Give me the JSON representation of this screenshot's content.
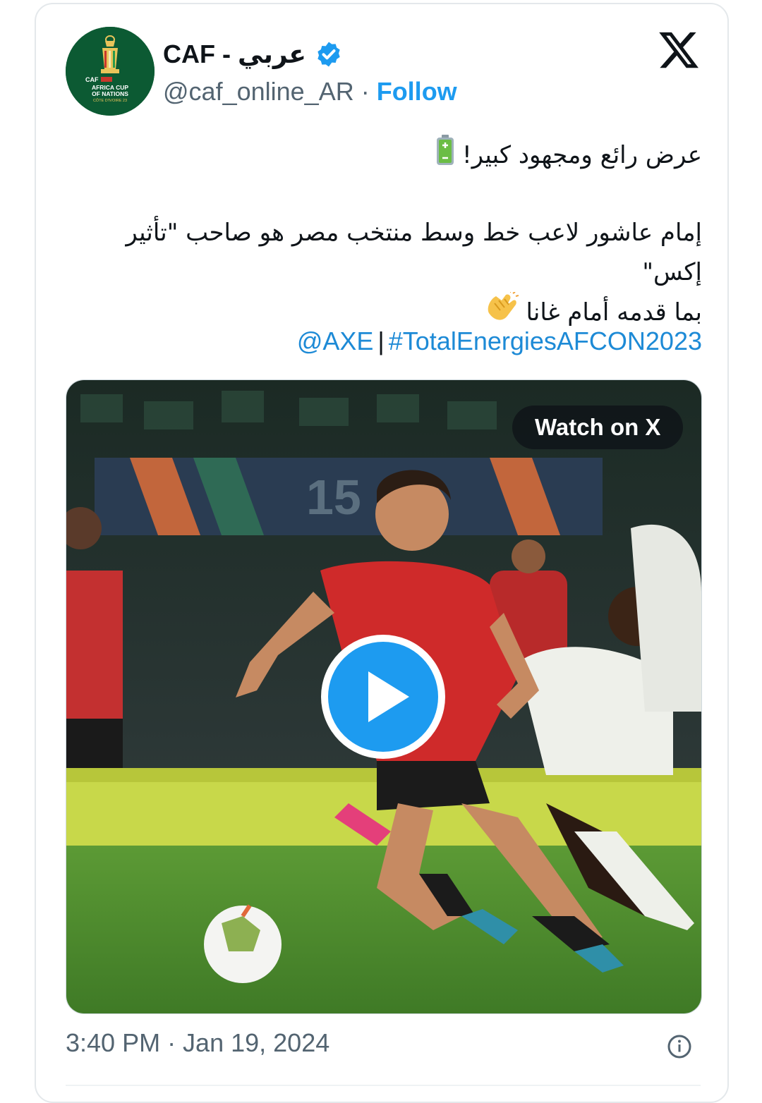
{
  "author": {
    "display_name": "CAF - عربي",
    "handle": "@caf_online_AR",
    "separator": "·",
    "follow_label": "Follow",
    "verified": true,
    "avatar_text": {
      "line1": "AFRICA CUP",
      "line2": "OF NATIONS",
      "line3": "CÔTE D'IVOIRE 23",
      "brand": "CAF"
    }
  },
  "tweet": {
    "line1": "عرض رائع ومجهود كبير!",
    "line1_emoji": "battery-icon",
    "line2": "إمام عاشور لاعب خط وسط منتخب مصر هو صاحب \"تأثير إكس\"",
    "line3": "بما قدمه أمام غانا",
    "line3_emoji": "clapping-hands-icon",
    "mention": "@AXE",
    "tag_separator": "|",
    "hashtag": "#TotalEnergiesAFCON2023"
  },
  "media": {
    "watch_label": "Watch on X",
    "play_icon": "play-icon",
    "background_number": "15"
  },
  "footer": {
    "timestamp": "3:40 PM · Jan 19, 2024",
    "info_icon": "info-icon"
  },
  "colors": {
    "link": "#1d9bf0",
    "hashtag": "#1d8ad6",
    "text": "#0f1419",
    "muted": "#536471",
    "verified": "#1d9bf0",
    "play_button": "#1d9bf0",
    "pitch": "#4f8a2e"
  }
}
